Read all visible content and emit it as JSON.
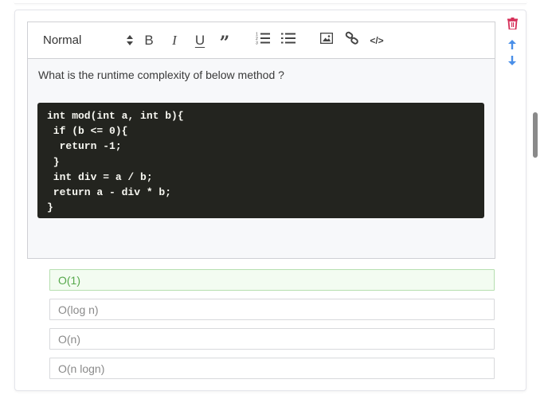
{
  "editor": {
    "toolbar": {
      "format_select": "Normal",
      "bold_label": "B",
      "italic_label": "I",
      "underline_label": "U",
      "quote_label": "”",
      "code_label": "</>"
    },
    "question": "What is the runtime complexity of below method ?",
    "code": "int mod(int a, int b){\n if (b <= 0){\n  return -1;\n }\n int div = a / b;\n return a - div * b;\n}"
  },
  "side_actions": {
    "delete_icon": "trash-icon",
    "move_up_icon": "arrow-up-icon",
    "move_down_icon": "arrow-down-icon"
  },
  "answers": [
    {
      "label": "O(1)",
      "correct": true
    },
    {
      "label": "O(log n)",
      "correct": false
    },
    {
      "label": "O(n)",
      "correct": false
    },
    {
      "label": "O(n logn)",
      "correct": false
    }
  ],
  "colors": {
    "delete": "#d6305a",
    "move": "#4a8fe8",
    "correct_text": "#56a84b",
    "correct_bg": "#f3fcf1",
    "code_bg": "#23241f"
  }
}
